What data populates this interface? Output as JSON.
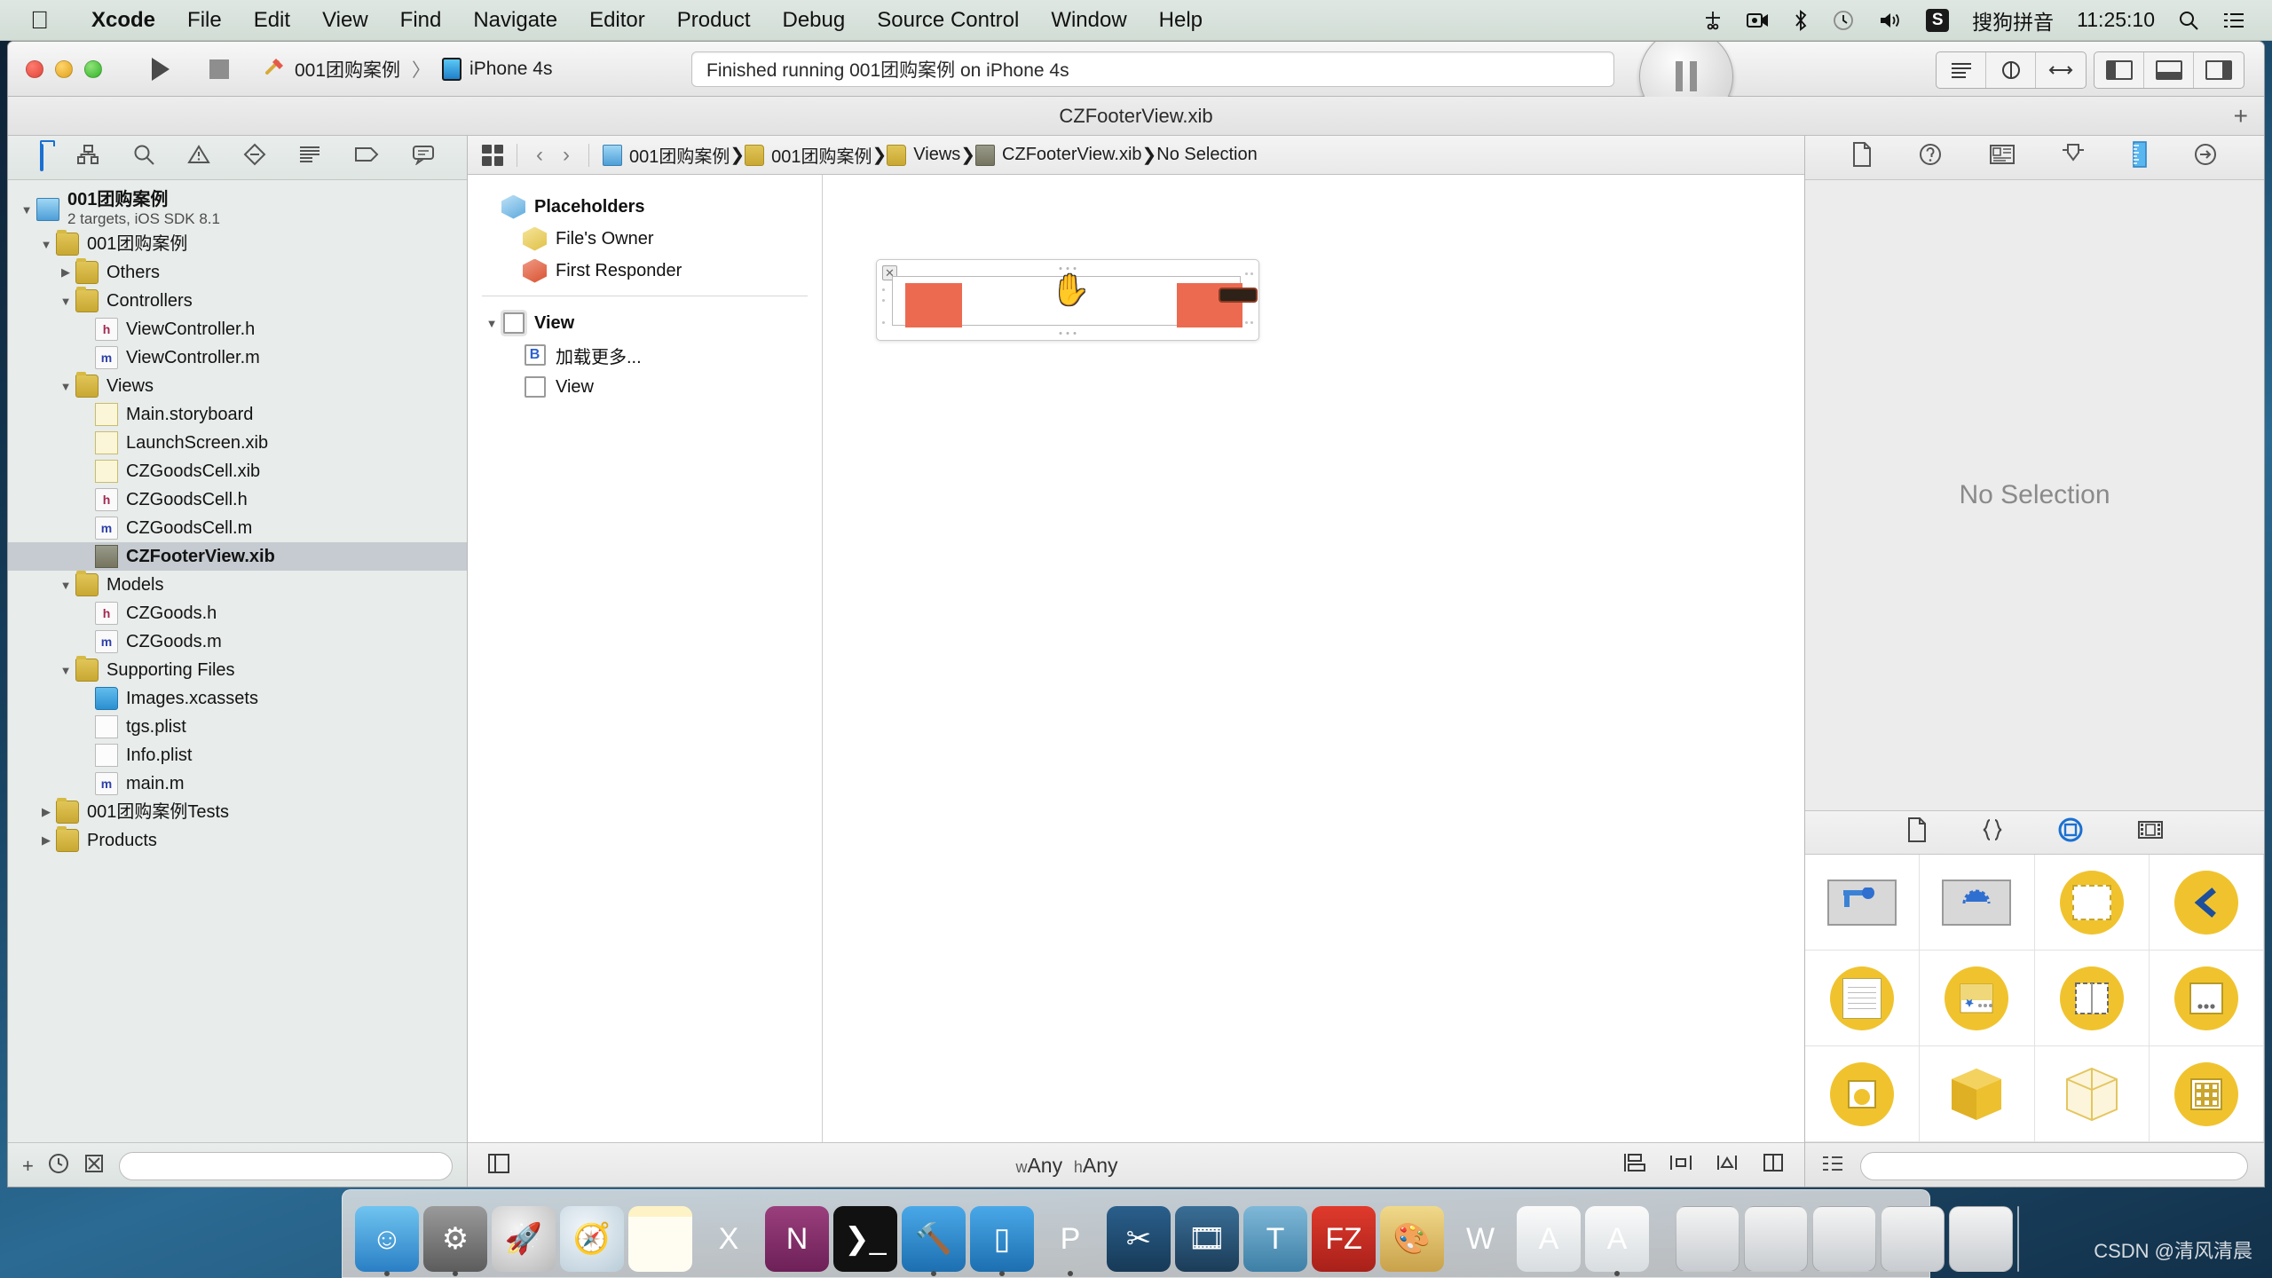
{
  "menubar": {
    "apple_icon": "apple-icon",
    "items": [
      {
        "label": "Xcode",
        "bold": true
      },
      {
        "label": "File",
        "bold": false
      },
      {
        "label": "Edit",
        "bold": false
      },
      {
        "label": "View",
        "bold": false
      },
      {
        "label": "Find",
        "bold": false
      },
      {
        "label": "Navigate",
        "bold": false
      },
      {
        "label": "Editor",
        "bold": false
      },
      {
        "label": "Product",
        "bold": false
      },
      {
        "label": "Debug",
        "bold": false
      },
      {
        "label": "Source Control",
        "bold": false
      },
      {
        "label": "Window",
        "bold": false
      },
      {
        "label": "Help",
        "bold": false
      }
    ],
    "status": {
      "scissors_icon": "scissors-icon",
      "screen_record_icon": "screen-record-icon",
      "bluetooth_icon": "bluetooth-icon",
      "timemachine_icon": "time-machine-icon",
      "volume_icon": "volume-icon",
      "input_badge": "S",
      "input_method": "搜狗拼音",
      "clock": "11:25:10",
      "spotlight_icon": "search-icon",
      "notification_icon": "notification-center-icon"
    }
  },
  "toolbar": {
    "run_icon": "play-icon",
    "stop_icon": "stop-icon",
    "scheme_name": "001团购案例",
    "scheme_separator": "〉",
    "destination": "iPhone 4s",
    "status_text": "Finished running 001团购案例 on iPhone 4s",
    "activity_icon": "pause-icon",
    "editor_segment": [
      "standard-editor-icon",
      "assistant-editor-icon",
      "version-editor-icon"
    ],
    "view_segment": [
      "navigator-toggle-icon",
      "debug-area-toggle-icon",
      "utilities-toggle-icon"
    ]
  },
  "window": {
    "title": "CZFooterView.xib",
    "add_tab_icon": "plus-icon"
  },
  "navigator": {
    "tabs": [
      {
        "name": "project-navigator",
        "icon": "folder-icon",
        "selected": true
      },
      {
        "name": "symbol-navigator",
        "icon": "symbol-icon",
        "selected": false
      },
      {
        "name": "find-navigator",
        "icon": "search-icon",
        "selected": false
      },
      {
        "name": "issue-navigator",
        "icon": "warning-icon",
        "selected": false
      },
      {
        "name": "test-navigator",
        "icon": "test-diamond-icon",
        "selected": false
      },
      {
        "name": "debug-navigator",
        "icon": "debug-list-icon",
        "selected": false
      },
      {
        "name": "breakpoint-navigator",
        "icon": "breakpoint-tag-icon",
        "selected": false
      },
      {
        "name": "report-navigator",
        "icon": "report-bubble-icon",
        "selected": false
      }
    ],
    "tree": [
      {
        "label": "001团购案例",
        "sub": "2 targets, iOS SDK 8.1",
        "indent": 0,
        "twisty": "down",
        "icon": "proj",
        "bold": true,
        "selected": false
      },
      {
        "label": "001团购案例",
        "sub": "",
        "indent": 1,
        "twisty": "down",
        "icon": "folder",
        "bold": false,
        "selected": false
      },
      {
        "label": "Others",
        "sub": "",
        "indent": 2,
        "twisty": "right",
        "icon": "folder",
        "bold": false,
        "selected": false
      },
      {
        "label": "Controllers",
        "sub": "",
        "indent": 2,
        "twisty": "down",
        "icon": "folder",
        "bold": false,
        "selected": false
      },
      {
        "label": "ViewController.h",
        "sub": "",
        "indent": 3,
        "twisty": "none",
        "icon": "h",
        "bold": false,
        "selected": false
      },
      {
        "label": "ViewController.m",
        "sub": "",
        "indent": 3,
        "twisty": "none",
        "icon": "m",
        "bold": false,
        "selected": false
      },
      {
        "label": "Views",
        "sub": "",
        "indent": 2,
        "twisty": "down",
        "icon": "folder",
        "bold": false,
        "selected": false
      },
      {
        "label": "Main.storyboard",
        "sub": "",
        "indent": 3,
        "twisty": "none",
        "icon": "xib",
        "bold": false,
        "selected": false
      },
      {
        "label": "LaunchScreen.xib",
        "sub": "",
        "indent": 3,
        "twisty": "none",
        "icon": "xib",
        "bold": false,
        "selected": false
      },
      {
        "label": "CZGoodsCell.xib",
        "sub": "",
        "indent": 3,
        "twisty": "none",
        "icon": "xib",
        "bold": false,
        "selected": false
      },
      {
        "label": "CZGoodsCell.h",
        "sub": "",
        "indent": 3,
        "twisty": "none",
        "icon": "h",
        "bold": false,
        "selected": false
      },
      {
        "label": "CZGoodsCell.m",
        "sub": "",
        "indent": 3,
        "twisty": "none",
        "icon": "m",
        "bold": false,
        "selected": false
      },
      {
        "label": "CZFooterView.xib",
        "sub": "",
        "indent": 3,
        "twisty": "none",
        "icon": "xibsel",
        "bold": true,
        "selected": true
      },
      {
        "label": "Models",
        "sub": "",
        "indent": 2,
        "twisty": "down",
        "icon": "folder",
        "bold": false,
        "selected": false
      },
      {
        "label": "CZGoods.h",
        "sub": "",
        "indent": 3,
        "twisty": "none",
        "icon": "h",
        "bold": false,
        "selected": false
      },
      {
        "label": "CZGoods.m",
        "sub": "",
        "indent": 3,
        "twisty": "none",
        "icon": "m",
        "bold": false,
        "selected": false
      },
      {
        "label": "Supporting Files",
        "sub": "",
        "indent": 2,
        "twisty": "down",
        "icon": "folder",
        "bold": false,
        "selected": false
      },
      {
        "label": "Images.xcassets",
        "sub": "",
        "indent": 3,
        "twisty": "none",
        "icon": "asset",
        "bold": false,
        "selected": false
      },
      {
        "label": "tgs.plist",
        "sub": "",
        "indent": 3,
        "twisty": "none",
        "icon": "plist",
        "bold": false,
        "selected": false
      },
      {
        "label": "Info.plist",
        "sub": "",
        "indent": 3,
        "twisty": "none",
        "icon": "plist",
        "bold": false,
        "selected": false
      },
      {
        "label": "main.m",
        "sub": "",
        "indent": 3,
        "twisty": "none",
        "icon": "m",
        "bold": false,
        "selected": false
      },
      {
        "label": "001团购案例Tests",
        "sub": "",
        "indent": 1,
        "twisty": "right",
        "icon": "folder",
        "bold": false,
        "selected": false
      },
      {
        "label": "Products",
        "sub": "",
        "indent": 1,
        "twisty": "right",
        "icon": "folder",
        "bold": false,
        "selected": false
      }
    ],
    "footer": {
      "add_icon": "plus-icon",
      "recent_icon": "clock-icon",
      "source_control_icon": "source-control-icon",
      "filter_placeholder": "",
      "filter_value": "",
      "filter_icon": "filter-icon"
    }
  },
  "jumpbar": {
    "grid_icon": "related-items-icon",
    "back_icon": "chevron-left-icon",
    "forward_icon": "chevron-right-icon",
    "crumbs": [
      {
        "label": "001团购案例",
        "icon": "proj"
      },
      {
        "label": "001团购案例",
        "icon": "fold"
      },
      {
        "label": "Views",
        "icon": "fold"
      },
      {
        "label": "CZFooterView.xib",
        "icon": "xib"
      },
      {
        "label": "No Selection",
        "icon": "none"
      }
    ]
  },
  "outline": {
    "rows": [
      {
        "label": "Placeholders",
        "icon": "cube-blue",
        "indent": 0,
        "bold": true,
        "twisty": "none"
      },
      {
        "label": "File's Owner",
        "icon": "cube-yellow",
        "indent": 1,
        "bold": false,
        "twisty": "none"
      },
      {
        "label": "First Responder",
        "icon": "cube-red",
        "indent": 1,
        "bold": false,
        "twisty": "none"
      },
      {
        "label": "View",
        "icon": "sq-framed",
        "indent": 0,
        "bold": true,
        "twisty": "down"
      },
      {
        "label": "加载更多...",
        "icon": "b-button",
        "indent": 1,
        "bold": false,
        "twisty": "none"
      },
      {
        "label": "View",
        "icon": "sq",
        "indent": 1,
        "bold": false,
        "twisty": "none"
      }
    ]
  },
  "canvas": {
    "close_icon": "x-icon",
    "cursor_icon": "open-hand-cursor-icon",
    "subviews": [
      {
        "name": "left-image-view",
        "color": "#ec6a50"
      },
      {
        "name": "right-image-view",
        "color": "#ec6a50"
      },
      {
        "name": "load-more-button",
        "color": "#2d2118"
      }
    ]
  },
  "editor_footer": {
    "document_outline_icon": "document-outline-toggle-icon",
    "size_class_w": "w",
    "size_class_w_value": "Any",
    "size_class_h": "h",
    "size_class_h_value": "Any",
    "tools": [
      "align-icon",
      "pin-icon",
      "resolve-issues-icon",
      "resizing-behavior-icon"
    ]
  },
  "inspector": {
    "tabs": [
      {
        "name": "file-inspector",
        "icon": "document-icon",
        "selected": false
      },
      {
        "name": "quick-help-inspector",
        "icon": "question-circle-icon",
        "selected": false
      },
      {
        "name": "identity-inspector",
        "icon": "identity-card-icon",
        "selected": false
      },
      {
        "name": "attributes-inspector",
        "icon": "attributes-slider-icon",
        "selected": false
      },
      {
        "name": "size-inspector",
        "icon": "ruler-icon",
        "selected": true
      },
      {
        "name": "connections-inspector",
        "icon": "arrow-circle-icon",
        "selected": false
      }
    ],
    "empty_message": "No Selection"
  },
  "library": {
    "tabs": [
      {
        "name": "file-template-library",
        "icon": "document-icon",
        "selected": false
      },
      {
        "name": "code-snippet-library",
        "icon": "braces-icon",
        "selected": false
      },
      {
        "name": "object-library",
        "icon": "object-circle-icon",
        "selected": true
      },
      {
        "name": "media-library",
        "icon": "film-strip-icon",
        "selected": false
      }
    ],
    "items": [
      {
        "name": "gesture-recognizer-item",
        "style": "sq-blue"
      },
      {
        "name": "tap-gesture-item",
        "style": "sq-dashed"
      },
      {
        "name": "view-controller-item",
        "style": "circle-dashed-top"
      },
      {
        "name": "navigation-controller-item",
        "style": "circle-chevron"
      },
      {
        "name": "table-view-item",
        "style": "circle-lines"
      },
      {
        "name": "tab-bar-controller-item",
        "style": "circle-star"
      },
      {
        "name": "split-view-item",
        "style": "circle-split"
      },
      {
        "name": "toolbar-item",
        "style": "circle-dots"
      },
      {
        "name": "image-view-item",
        "style": "circle-photo"
      },
      {
        "name": "object-item",
        "style": "cube-solid"
      },
      {
        "name": "external-object-item",
        "style": "cube-wire"
      },
      {
        "name": "collection-view-item",
        "style": "circle-grid"
      }
    ],
    "footer": {
      "list_view_icon": "list-view-icon",
      "filter_icon": "filter-icon",
      "filter_value": ""
    }
  },
  "dock": {
    "apps": [
      {
        "name": "finder",
        "label": "☺",
        "bg": "linear-gradient(180deg,#6fc4f0,#2a7fc5)",
        "running": true
      },
      {
        "name": "system-preferences",
        "label": "⚙",
        "bg": "linear-gradient(180deg,#9a9a9a,#5c5c5c)",
        "running": true
      },
      {
        "name": "launchpad",
        "label": "🚀",
        "bg": "radial-gradient(circle at 40% 35%,#f4f4f4,#b8b8b8)",
        "running": false
      },
      {
        "name": "safari",
        "label": "🧭",
        "bg": "radial-gradient(circle at 40% 35%,#f2f7fb,#b9ccd8)",
        "running": false
      },
      {
        "name": "notes",
        "label": "",
        "bg": "linear-gradient(180deg,#fdf3c6 0 16%,#fffdf2 16%)",
        "running": false
      },
      {
        "name": "excel",
        "label": "X",
        "bg": "transparent",
        "running": false
      },
      {
        "name": "onenote",
        "label": "N",
        "bg": "linear-gradient(180deg,#9a3f7d,#6d2057)",
        "running": false
      },
      {
        "name": "terminal",
        "label": "❯_",
        "bg": "#111111",
        "running": false
      },
      {
        "name": "xcode",
        "label": "🔨",
        "bg": "linear-gradient(180deg,#4aa8e8,#1c6fb0)",
        "running": true
      },
      {
        "name": "simulator",
        "label": "▯",
        "bg": "linear-gradient(180deg,#4aa8e8,#1c6fb0)",
        "running": true
      },
      {
        "name": "pages-alt",
        "label": "P",
        "bg": "transparent",
        "running": true
      },
      {
        "name": "snipping-tool",
        "label": "✂",
        "bg": "linear-gradient(180deg,#2a5f8c,#173a57)",
        "running": false
      },
      {
        "name": "screen-recorder",
        "label": "🎞",
        "bg": "linear-gradient(180deg,#3a6e96,#1b3c58)",
        "running": false
      },
      {
        "name": "typora",
        "label": "T",
        "bg": "linear-gradient(180deg,#7fb8d8,#3d7fa6)",
        "running": false
      },
      {
        "name": "filezilla",
        "label": "FZ",
        "bg": "linear-gradient(180deg,#e03a2c,#a8201a)",
        "running": false
      },
      {
        "name": "paint",
        "label": "🎨",
        "bg": "linear-gradient(180deg,#f0d98a,#c9a14a)",
        "running": false
      },
      {
        "name": "word",
        "label": "W",
        "bg": "transparent",
        "running": false
      },
      {
        "name": "xcode-doc-a",
        "label": "A",
        "bg": "linear-gradient(180deg,#fafafa,#d8dde0)",
        "running": false
      },
      {
        "name": "xcode-doc-b",
        "label": "A",
        "bg": "linear-gradient(180deg,#fafafa,#d8dde0)",
        "running": true
      }
    ],
    "minimized": [
      {
        "name": "minimized-window-1"
      },
      {
        "name": "minimized-window-2"
      },
      {
        "name": "minimized-window-3"
      },
      {
        "name": "minimized-window-4"
      },
      {
        "name": "minimized-window-5"
      }
    ],
    "trash_name": "trash"
  },
  "watermark": "CSDN @清风清晨"
}
